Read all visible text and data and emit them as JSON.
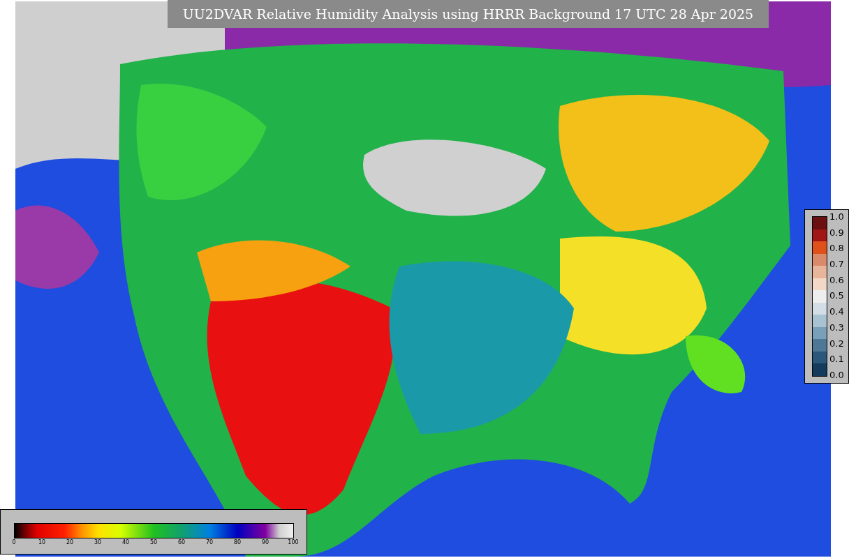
{
  "title": "UU2DVAR Relative Humidity Analysis using HRRR Background 17 UTC 28 Apr 2025",
  "humidity_scale": {
    "ticks": [
      "0",
      "10",
      "20",
      "30",
      "40",
      "50",
      "60",
      "70",
      "80",
      "90",
      "100"
    ]
  },
  "obs_scale": {
    "ticks": [
      "1.0",
      "0.9",
      "0.8",
      "0.7",
      "0.6",
      "0.5",
      "0.4",
      "0.3",
      "0.2",
      "0.1",
      "0.0"
    ]
  }
}
